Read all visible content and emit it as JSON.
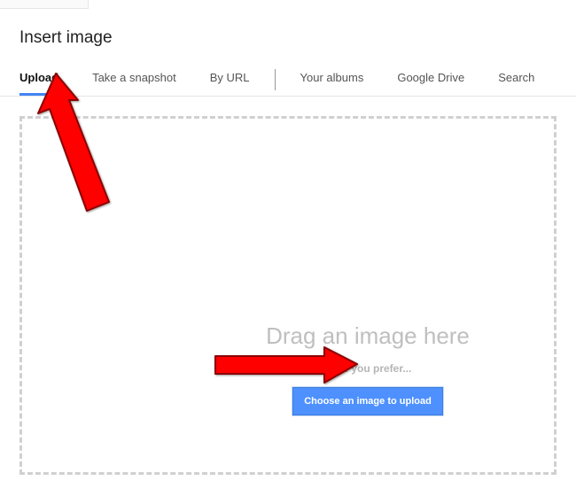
{
  "dialog": {
    "title": "Insert image"
  },
  "tabs": {
    "upload": "Upload",
    "snapshot": "Take a snapshot",
    "byurl": "By URL",
    "albums": "Your albums",
    "drive": "Google Drive",
    "search": "Search"
  },
  "dropzone": {
    "dragText": "Drag an image here",
    "orText": "Or, if you prefer...",
    "chooseButton": "Choose an image to upload"
  }
}
